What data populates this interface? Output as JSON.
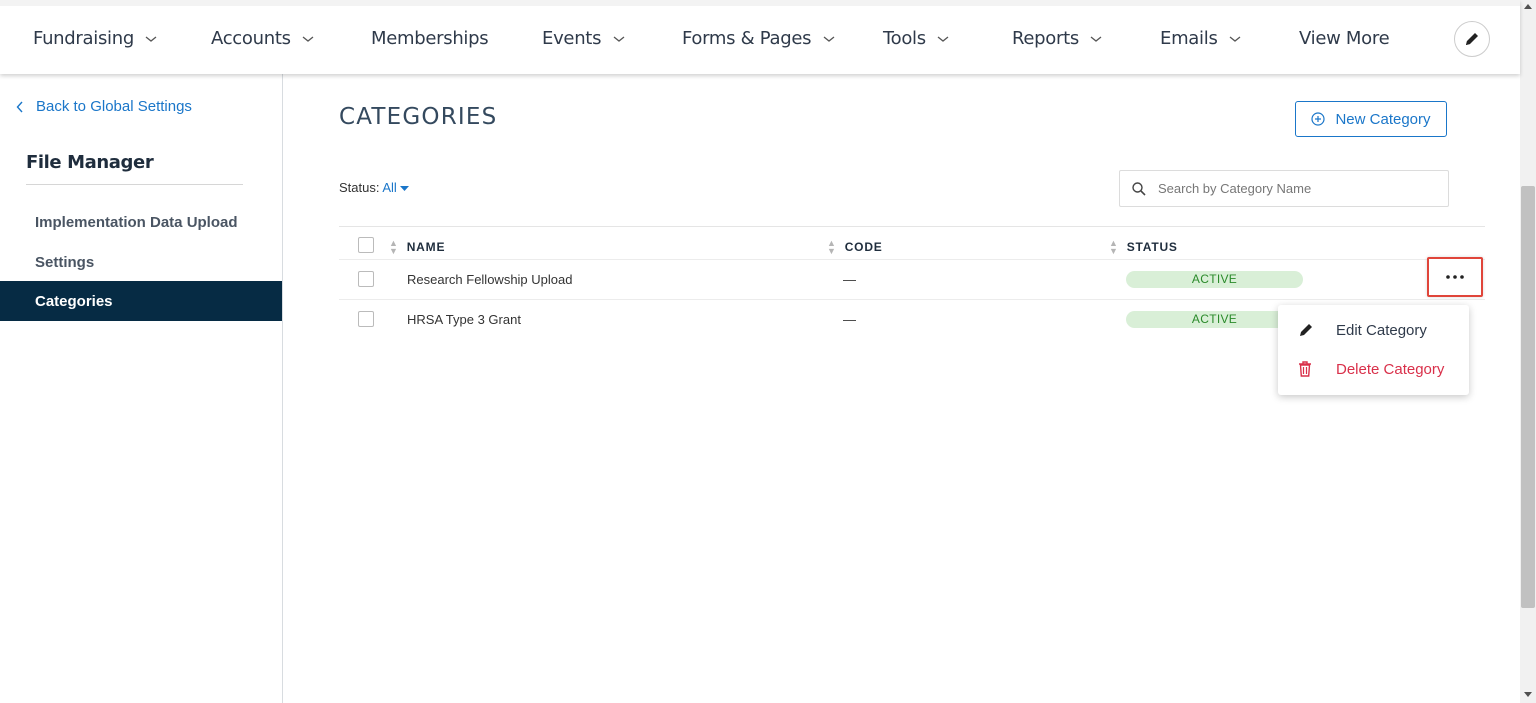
{
  "nav": {
    "items": [
      {
        "label": "Fundraising",
        "dropdown": true
      },
      {
        "label": "Accounts",
        "dropdown": true
      },
      {
        "label": "Memberships",
        "dropdown": false
      },
      {
        "label": "Events",
        "dropdown": true
      },
      {
        "label": "Forms & Pages",
        "dropdown": true
      },
      {
        "label": "Tools",
        "dropdown": true
      },
      {
        "label": "Reports",
        "dropdown": true
      },
      {
        "label": "Emails",
        "dropdown": true
      },
      {
        "label": "View More",
        "dropdown": false
      }
    ],
    "edit_icon": "pencil-icon"
  },
  "sidebar": {
    "back_label": "Back to Global Settings",
    "section_title": "File Manager",
    "items": [
      {
        "label": "Implementation Data Upload",
        "active": false
      },
      {
        "label": "Settings",
        "active": false
      },
      {
        "label": "Categories",
        "active": true
      }
    ]
  },
  "main": {
    "title": "CATEGORIES",
    "new_button_label": "New Category",
    "status_filter": {
      "label": "Status:",
      "value": "All"
    },
    "search": {
      "placeholder": "Search by Category Name",
      "value": ""
    },
    "table": {
      "columns": [
        "NAME",
        "CODE",
        "STATUS"
      ],
      "rows": [
        {
          "name": "Research Fellowship Upload",
          "code": "—",
          "status": "ACTIVE"
        },
        {
          "name": "HRSA Type 3 Grant",
          "code": "—",
          "status": "ACTIVE"
        }
      ]
    },
    "row_menu": {
      "items": [
        {
          "label": "Edit Category",
          "icon": "pencil-icon"
        },
        {
          "label": "Delete Category",
          "icon": "trash-icon"
        }
      ]
    }
  },
  "colors": {
    "accent": "#1a76c9",
    "sidebar_active": "#062b44",
    "badge_bg": "#d9efd7",
    "badge_text": "#2a8a2a",
    "danger": "#d9304a",
    "highlight_border": "#e0453a"
  }
}
